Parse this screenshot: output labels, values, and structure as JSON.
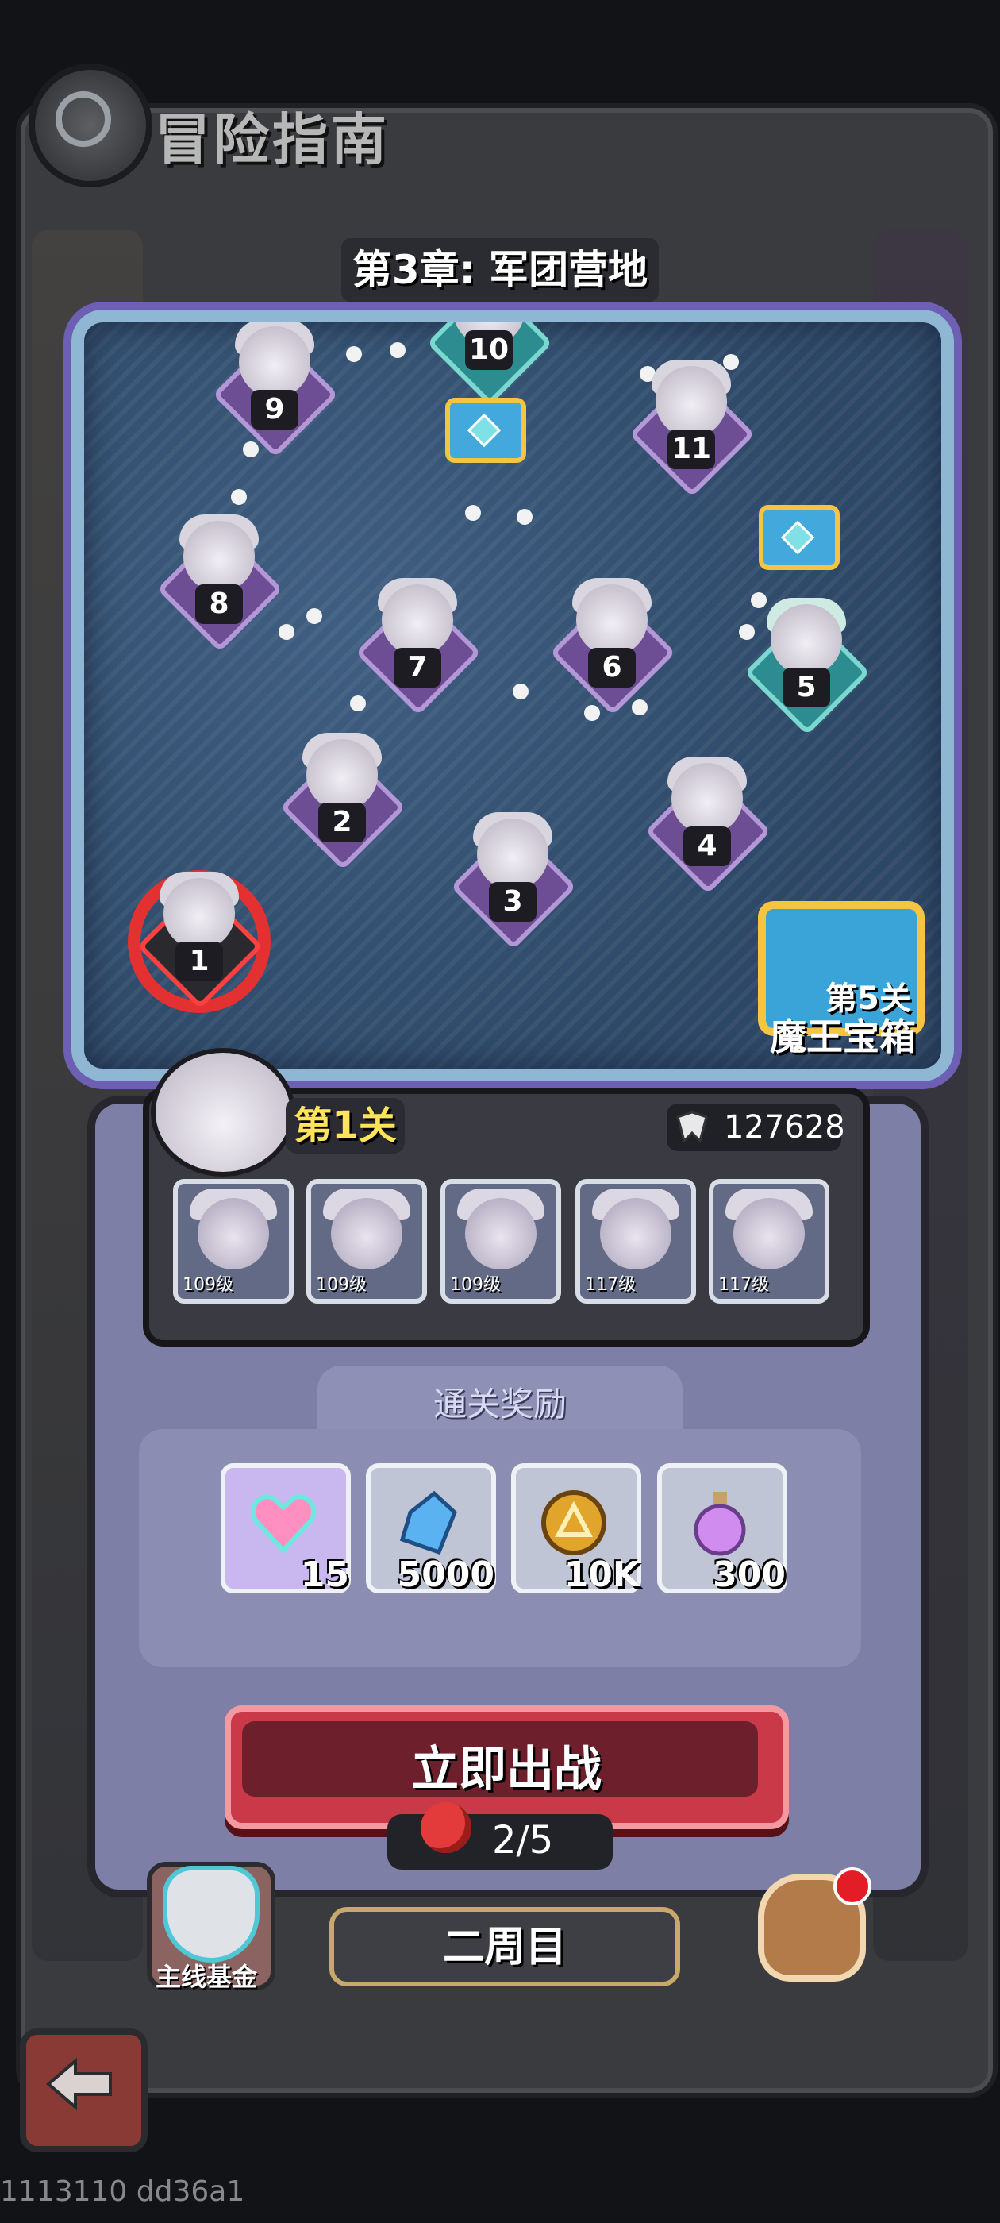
{
  "header": {
    "title": "冒险指南",
    "chapter": "第3章: 军团营地"
  },
  "map": {
    "nodes": [
      "1",
      "2",
      "3",
      "4",
      "5",
      "6",
      "7",
      "8",
      "9",
      "10",
      "11"
    ],
    "boss_chest_label_line1": "第5关",
    "boss_chest_label_line2": "魔王宝箱"
  },
  "stage": {
    "name": "第1关",
    "power": "127628",
    "heroes": [
      {
        "level": "109级"
      },
      {
        "level": "109级"
      },
      {
        "level": "109级"
      },
      {
        "level": "117级"
      },
      {
        "level": "117级"
      }
    ]
  },
  "rewards": {
    "title": "通关奖励",
    "items": [
      {
        "icon": "heart-gem-icon",
        "count": "15"
      },
      {
        "icon": "blue-crystal-icon",
        "count": "5000"
      },
      {
        "icon": "gold-coin-icon",
        "count": "10K"
      },
      {
        "icon": "potion-bottle-icon",
        "count": "300"
      }
    ]
  },
  "actions": {
    "battle": "立即出战",
    "stamina": "2/5",
    "fund": "主线基金",
    "second_round": "二周目"
  },
  "footer": {
    "debug_code": "1113110 dd36a1"
  },
  "colors": {
    "battle_button": "#c93947",
    "stage_name": "#ffe45a",
    "map_border": "#8fb7d4"
  }
}
